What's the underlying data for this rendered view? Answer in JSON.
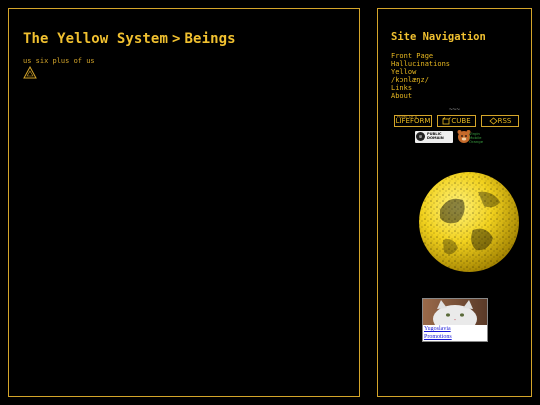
{
  "main": {
    "breadcrumb_parent": "The Yellow System",
    "breadcrumb_separator": ">",
    "breadcrumb_current": "Beings",
    "subline": "us six plus of us"
  },
  "sidebar": {
    "title": "Site Navigation",
    "nav_items": [
      {
        "label": "Front Page"
      },
      {
        "label": "Hallucinations"
      },
      {
        "label": "Yellow"
      },
      {
        "label": "/kɔnlæŋz/"
      },
      {
        "label": "Links"
      },
      {
        "label": "About"
      }
    ],
    "tiny_mark": "~~~",
    "badges": {
      "lifeform_small": "HOME OF A",
      "lifeform": "LIFEFORM",
      "cube": "CUBE",
      "rss": "RSS",
      "public_domain_line1": "PUBLIC",
      "public_domain_line2": "DOMAIN",
      "vmi_text": "Virgin Mobile Orange"
    },
    "promo": {
      "line1": "Yugoslavia",
      "line2": "Promotions"
    }
  },
  "colors": {
    "accent": "#f0c030",
    "border": "#d4a52a",
    "background": "#000000",
    "link_blue": "#1a1ad8"
  },
  "icons": [
    "triangle-icon",
    "cube-icon",
    "rss-icon",
    "public-domain-icon",
    "earth-globe-icon",
    "cat-photo-icon"
  ]
}
